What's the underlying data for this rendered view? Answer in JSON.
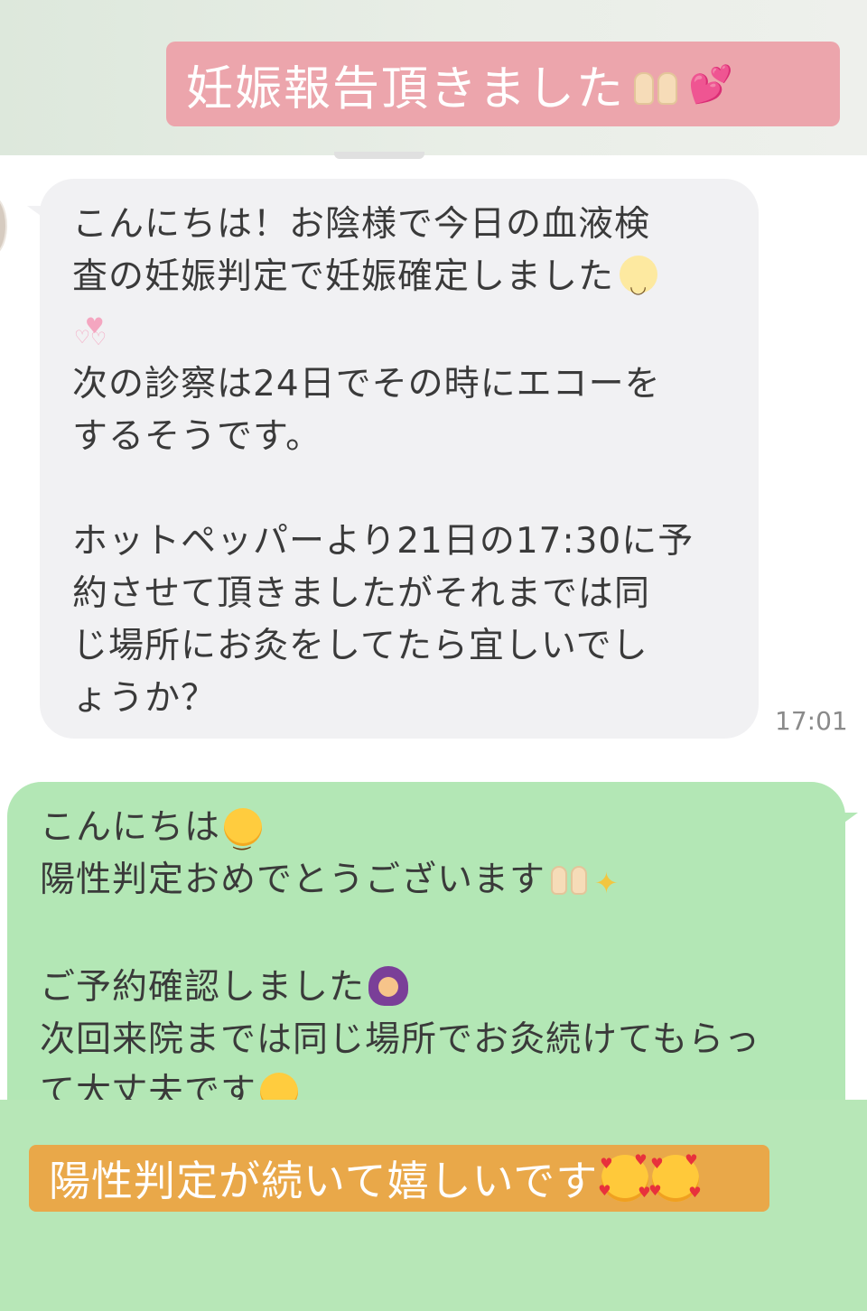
{
  "captions": {
    "top": "妊娠報告頂きました",
    "bottom": "陽性判定が続いて嬉しいです"
  },
  "incoming_message": {
    "lines": [
      "こんにちは！お陰様で今日の血液検",
      "査の妊娠判定で妊娠確定しました",
      "",
      "次の診察は24日でその時にエコーを",
      "するそうです。",
      "",
      "ホットペッパーより21日の17:30に予",
      "約させて頂きましたがそれまでは同",
      "じ場所にお灸をしてたら宜しいでし",
      "ょうか？"
    ],
    "time": "17:01"
  },
  "outgoing_message": {
    "lines": [
      "こんにちは",
      "陽性判定おめでとうございます",
      "",
      "ご予約確認しました",
      "次回来院までは同じ場所でお灸続けてもらっ",
      "て大丈夫です"
    ]
  },
  "colors": {
    "top_caption_bg": "#eca5ac",
    "bottom_caption_bg": "#e9a849",
    "incoming_bubble": "#f1f1f3",
    "outgoing_bubble": "#b3e7b5"
  },
  "icons": [
    "raising-hands-icon",
    "two-hearts-icon",
    "smile-icon",
    "pink-hearts-icon",
    "sparkles-icon",
    "person-gesturing-ok-icon",
    "smiling-face-with-hearts-icon"
  ]
}
